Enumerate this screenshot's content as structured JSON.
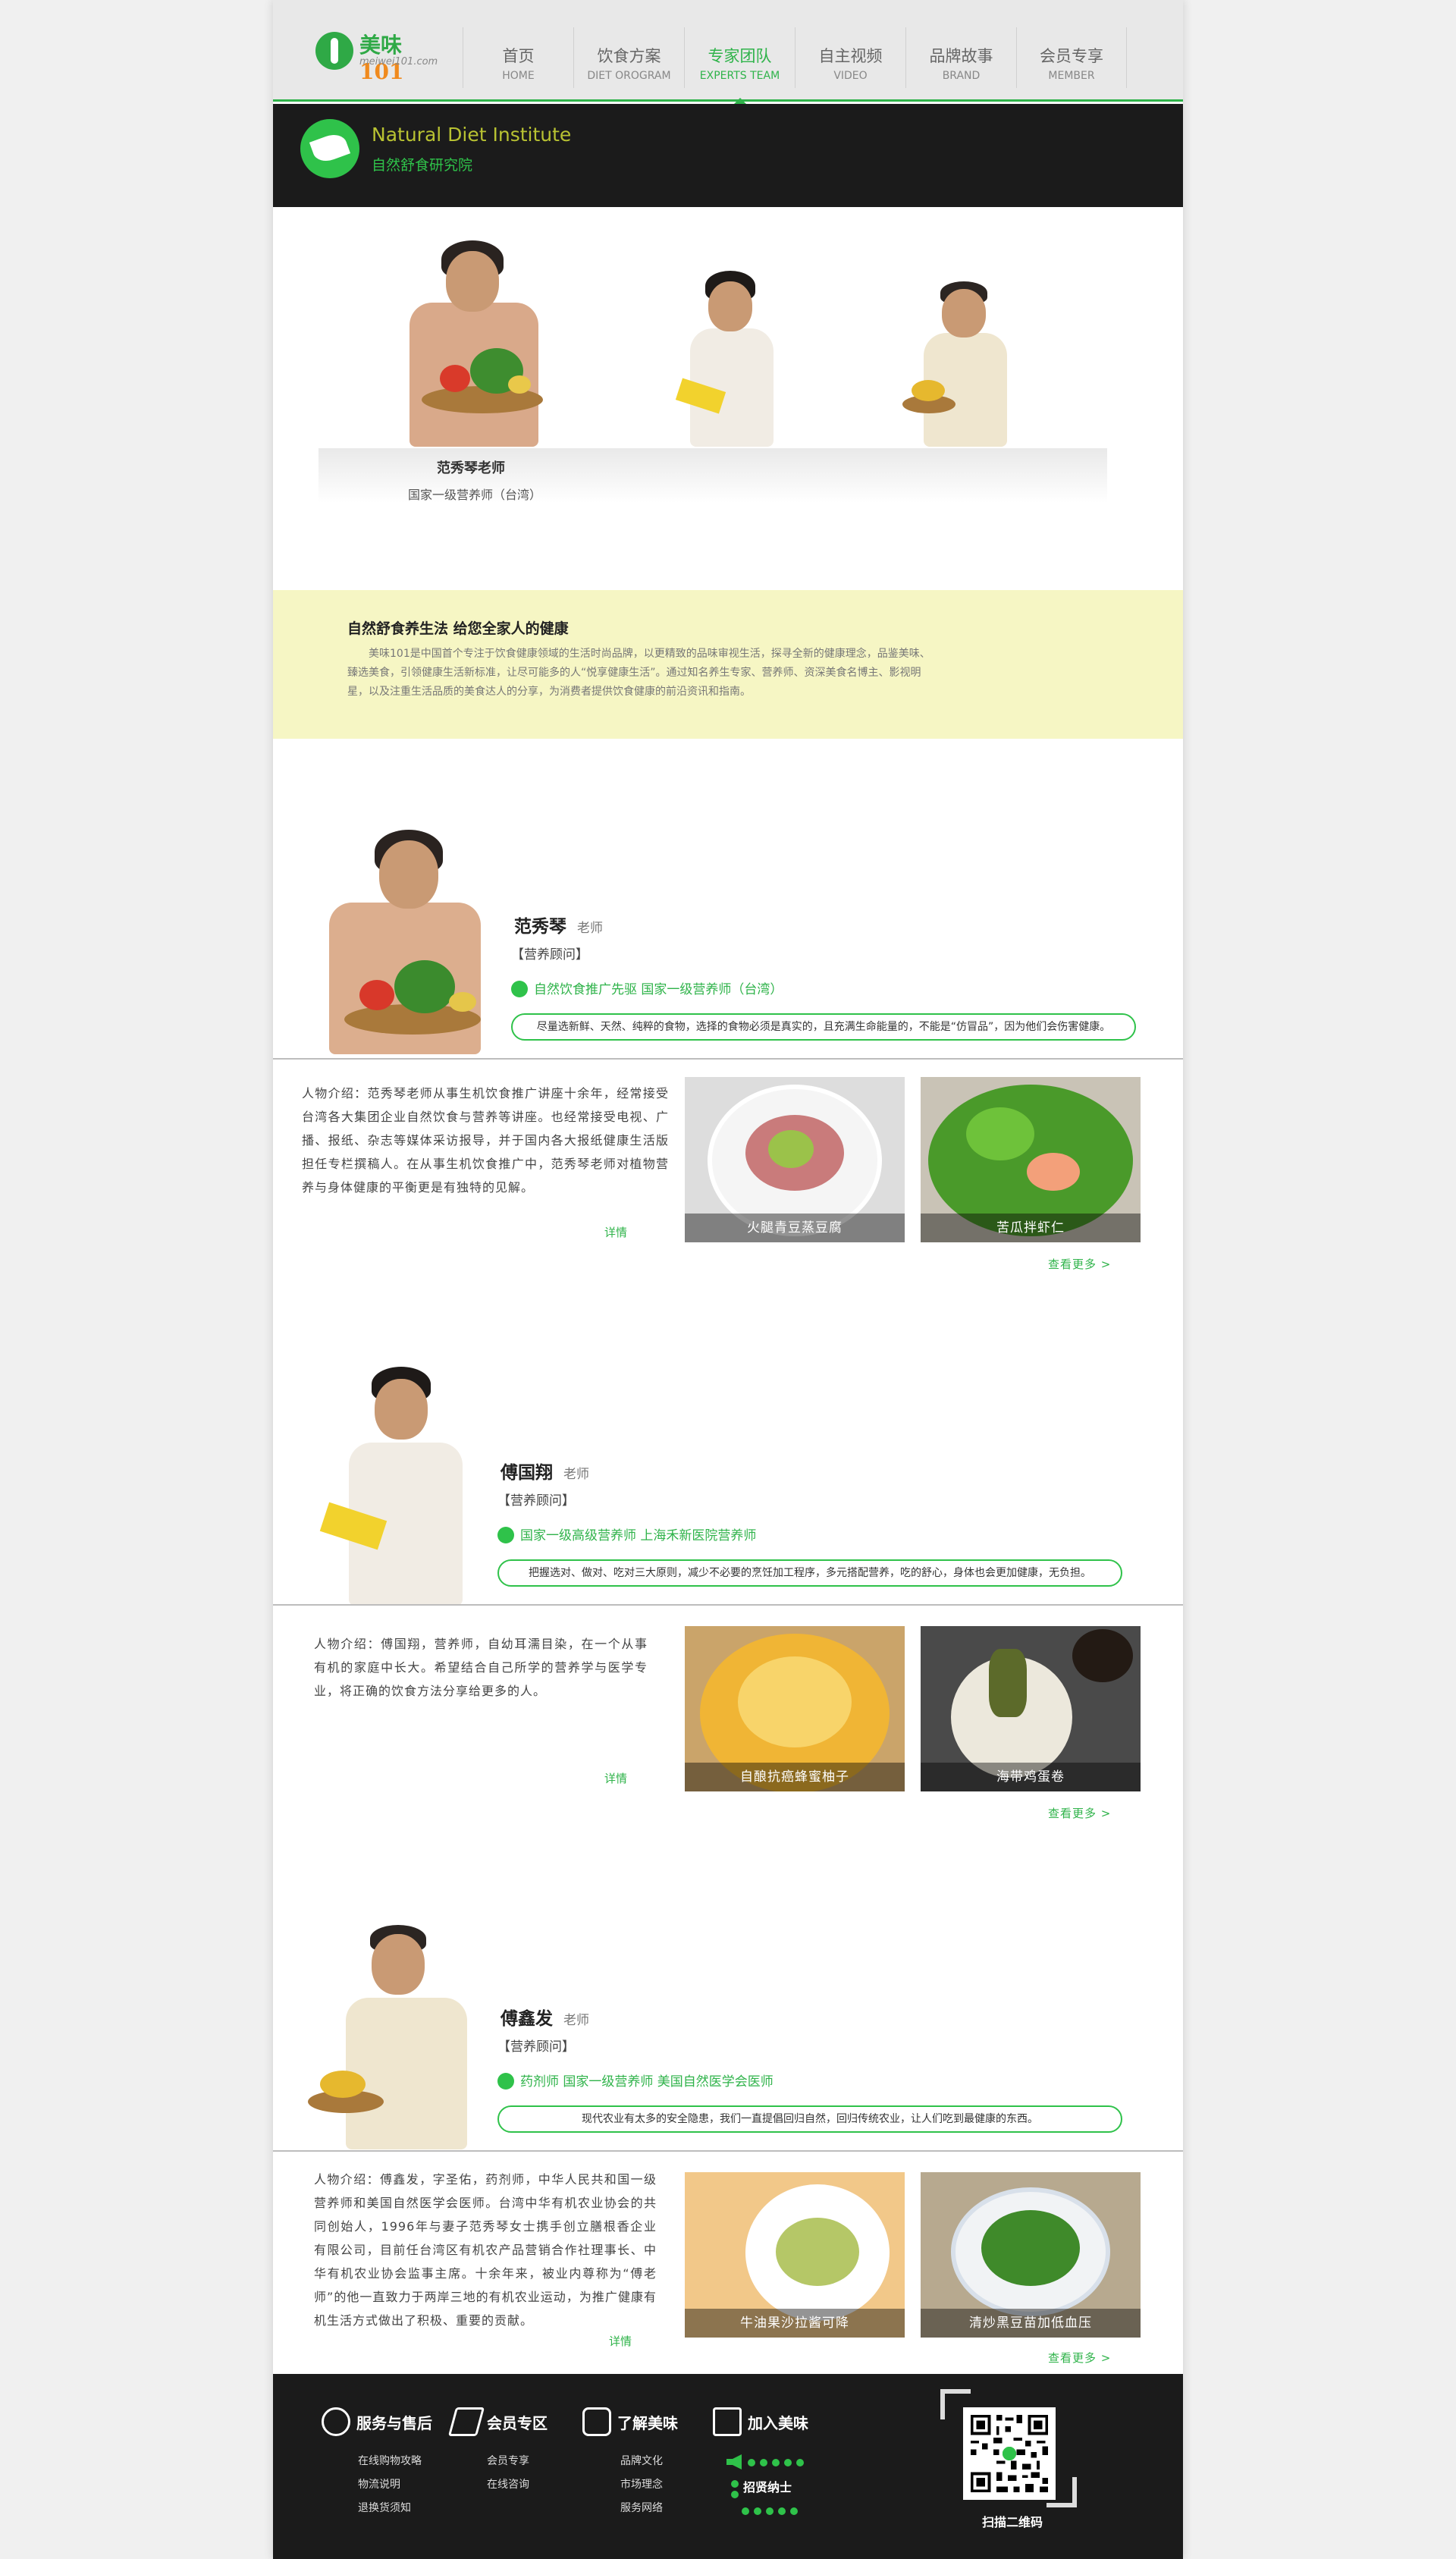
{
  "header": {
    "logo_text_main": "美味",
    "logo_text_num": "101",
    "logo_url_text": "meiwei101.com",
    "nav": [
      {
        "zh": "首页",
        "en": "HOME",
        "active": false
      },
      {
        "zh": "饮食方案",
        "en": "DIET OROGRAM",
        "active": false
      },
      {
        "zh": "专家团队",
        "en": "EXPERTS TEAM",
        "active": true
      },
      {
        "zh": "自主视频",
        "en": "VIDEO",
        "active": false
      },
      {
        "zh": "品牌故事",
        "en": "BRAND",
        "active": false
      },
      {
        "zh": "会员专享",
        "en": "MEMBER",
        "active": false
      }
    ]
  },
  "institute": {
    "name_en": "Natural Diet Institute",
    "name_zh": "自然舒食研究院"
  },
  "team": {
    "selected_name": "范秀琴老师",
    "selected_title": "国家一级营养师（台湾）"
  },
  "intro": {
    "heading": "自然舒食养生法 给您全家人的健康",
    "body": "美味101是中国首个专注于饮食健康领域的生活时尚品牌，以更精致的品味审视生活，探寻全新的健康理念，品鉴美味、臻选美食，引领健康生活新标准，让尽可能多的人“悦享健康生活”。通过知名养生专家、营养师、资深美食名博主、影视明星，以及注重生活品质的美食达人的分享，为消费者提供饮食健康的前沿资讯和指南。"
  },
  "experts": [
    {
      "name": "范秀琴",
      "honorific": "老师",
      "role": "【营养顾问】",
      "credentials": "自然饮食推广先驱 国家一级营养师（台湾）",
      "quote": "尽量选新鲜、天然、纯粹的食物，选择的食物必须是真实的，且充满生命能量的，不能是“仿冒品”，因为他们会伤害健康。",
      "bio": "人物介绍：范秀琴老师从事生机饮食推广讲座十余年，经常接受台湾各大集团企业自然饮食与营养等讲座。也经常接受电视、广播、报纸、杂志等媒体采访报导，并于国内各大报纸健康生活版担任专栏撰稿人。在从事生机饮食推广中，范秀琴老师对植物营养与身体健康的平衡更是有独特的见解。",
      "detail_link": "详情",
      "dishes": [
        "火腿青豆蒸豆腐",
        "苦瓜拌虾仁"
      ],
      "more_link": "查看更多 >"
    },
    {
      "name": "傅国翔",
      "honorific": "老师",
      "role": "【营养顾问】",
      "credentials": "国家一级高级营养师 上海禾新医院营养师",
      "quote": "把握选对、做对、吃对三大原则，减少不必要的烹饪加工程序，多元搭配营养，吃的舒心，身体也会更加健康，无负担。",
      "bio": "人物介绍：傅国翔，营养师，自幼耳濡目染，在一个从事有机的家庭中长大。希望结合自己所学的营养学与医学专业，将正确的饮食方法分享给更多的人。",
      "detail_link": "详情",
      "dishes": [
        "自酿抗癌蜂蜜柚子",
        "海带鸡蛋卷"
      ],
      "more_link": "查看更多 >"
    },
    {
      "name": "傅鑫发",
      "honorific": "老师",
      "role": "【营养顾问】",
      "credentials": "药剂师 国家一级营养师 美国自然医学会医师",
      "quote": "现代农业有太多的安全隐患，我们一直提倡回归自然，回归传统农业，让人们吃到最健康的东西。",
      "bio": "人物介绍：傅鑫发，字圣佑，药剂师，中华人民共和国一级营养师和美国自然医学会医师。台湾中华有机农业协会的共同创始人，1996年与妻子范秀琴女士携手创立膳根香企业有限公司，目前任台湾区有机农产品营销合作社理事长、中华有机农业协会监事主席。十余年来，被业内尊称为“傅老师”的他一直致力于两岸三地的有机农业运动，为推广健康有机生活方式做出了积极、重要的贡献。",
      "detail_link": "详情",
      "dishes": [
        "牛油果沙拉酱可降",
        "清炒黑豆苗加低血压"
      ],
      "more_link": "查看更多 >"
    }
  ],
  "footer": {
    "columns": [
      {
        "title": "服务与售后",
        "icon": "gear-icon",
        "items": [
          "在线购物攻略",
          "物流说明",
          "退换货须知"
        ]
      },
      {
        "title": "会员专区",
        "icon": "paper-plane-icon",
        "items": [
          "会员专享",
          "在线咨询"
        ]
      },
      {
        "title": "了解美味",
        "icon": "coins-icon",
        "items": [
          "品牌文化",
          "市场理念",
          "服务网络"
        ]
      },
      {
        "title": "加入美味",
        "icon": "shopping-bag-icon",
        "items": []
      }
    ],
    "hire_text": "招贤纳士",
    "qr_caption": "扫描二维码"
  },
  "colors": {
    "accent": "#2fb34a",
    "dark": "#1b1b1b",
    "intro_bg": "#f6f6c4"
  }
}
